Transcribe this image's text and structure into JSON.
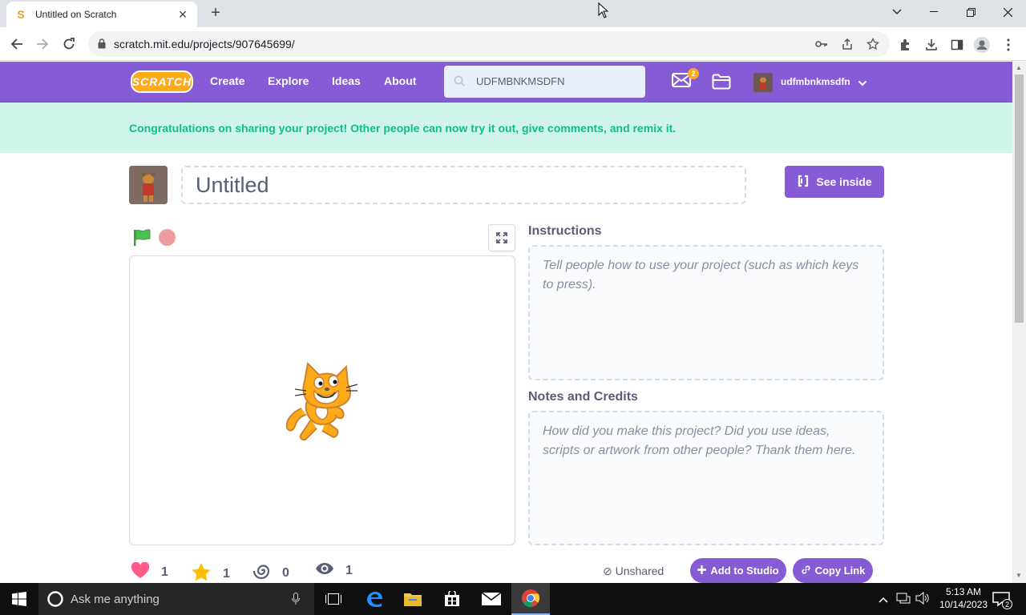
{
  "browser": {
    "tab_title": "Untitled on Scratch",
    "url": "scratch.mit.edu/projects/907645699/"
  },
  "navbar": {
    "logo_text": "SCRATCH",
    "links": [
      "Create",
      "Explore",
      "Ideas",
      "About"
    ],
    "search_value": "UDFMBNKMSDFN",
    "messages_count": "2",
    "username": "udfmbnkmsdfn"
  },
  "banner": {
    "text": "Congratulations on sharing your project! Other people can now try it out, give comments, and remix it."
  },
  "project": {
    "title": "Untitled",
    "see_inside_label": "See inside"
  },
  "instructions": {
    "label": "Instructions",
    "placeholder": "Tell people how to use your project (such as which keys to press)."
  },
  "notes": {
    "label": "Notes and Credits",
    "placeholder": "How did you make this project? Did you use ideas, scripts or artwork from other people? Thank them here."
  },
  "stats": {
    "loves": "1",
    "favorites": "1",
    "remixes": "0",
    "views": "1"
  },
  "share": {
    "status": "Unshared",
    "add_to_studio": "Add to Studio",
    "copy_link": "Copy Link"
  },
  "taskbar": {
    "search_placeholder": "Ask me anything",
    "time": "5:13 AM",
    "date": "10/14/2023",
    "notification_count": "2"
  },
  "colors": {
    "scratch_purple": "#855cd6",
    "banner_bg": "#d1f5eb",
    "banner_text": "#0fbd8c",
    "logo_orange": "#ffab19"
  }
}
